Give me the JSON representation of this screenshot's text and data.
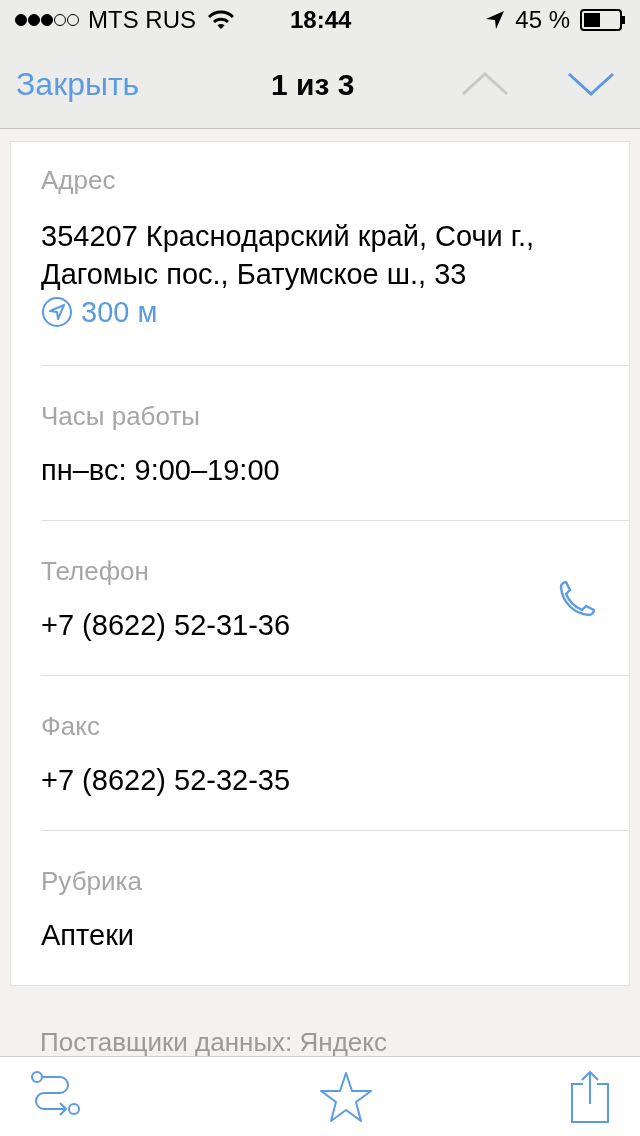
{
  "status_bar": {
    "carrier": "MTS RUS",
    "time": "18:44",
    "battery": "45 %"
  },
  "nav": {
    "close": "Закрыть",
    "title": "1 из 3",
    "prev": {
      "disabled": true
    },
    "next": {
      "disabled": false
    }
  },
  "fields": [
    {
      "kind": "address",
      "label": "Адрес",
      "value": "354207 Краснодарский край, Сочи г., Дагомыс пос., Батумское ш., 33",
      "distance": "300 м"
    },
    {
      "kind": "plain",
      "label": "Часы работы",
      "value": "пн–вс: 9:00–19:00"
    },
    {
      "kind": "phone",
      "label": "Телефон",
      "value": "+7 (8622) 52-31-36"
    },
    {
      "kind": "plain",
      "label": "Факс",
      "value": "+7 (8622) 52-32-35"
    },
    {
      "kind": "plain",
      "label": "Рубрика",
      "value": "Аптеки"
    }
  ],
  "footer": "Поставщики данных: Яндекс"
}
